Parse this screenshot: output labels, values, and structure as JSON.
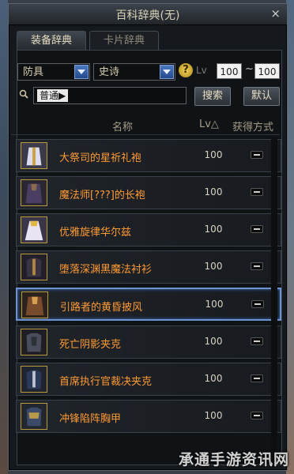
{
  "window": {
    "title": "百科辞典(无)",
    "close_glyph": "×"
  },
  "tabs": [
    {
      "label": "装备辞典",
      "active": true
    },
    {
      "label": "卡片辞典",
      "active": false
    }
  ],
  "filters": {
    "category": "防具",
    "rarity": "史诗",
    "help_glyph": "?",
    "level_label": "Lv",
    "level_min": "100",
    "level_separator": "~",
    "level_max": "100"
  },
  "search": {
    "value": "普通▶",
    "search_button": "搜索",
    "reset_button": "默认"
  },
  "table": {
    "columns": {
      "name": "名称",
      "level": "Lv△",
      "acquire": "获得方式"
    },
    "rows": [
      {
        "name": "大祭司的星祈礼袍",
        "level": "100",
        "icon": "white-robe-icon",
        "selected": false
      },
      {
        "name": "魔法师[???]的长袍",
        "level": "100",
        "icon": "dark-robe-icon",
        "selected": false
      },
      {
        "name": "优雅旋律华尔兹",
        "level": "100",
        "icon": "white-gold-dress-icon",
        "selected": false
      },
      {
        "name": "堕落深渊黑魔法衬衫",
        "level": "100",
        "icon": "dark-shirt-icon",
        "selected": false
      },
      {
        "name": "引路者的黄昏披风",
        "level": "100",
        "icon": "dusk-cloak-icon",
        "selected": true
      },
      {
        "name": "死亡阴影夹克",
        "level": "100",
        "icon": "shadow-jacket-icon",
        "selected": false
      },
      {
        "name": "首席执行官裁决夹克",
        "level": "100",
        "icon": "ceo-jacket-icon",
        "selected": false
      },
      {
        "name": "冲锋陷阵胸甲",
        "level": "100",
        "icon": "breastplate-icon",
        "selected": false
      }
    ]
  },
  "watermark": "承通手游资讯网",
  "colors": {
    "item_name": "#ff9a33",
    "selected_border": "#6d93d0",
    "dropdown_blue": "#244a8c",
    "thumb_border": "#b99a3c"
  }
}
